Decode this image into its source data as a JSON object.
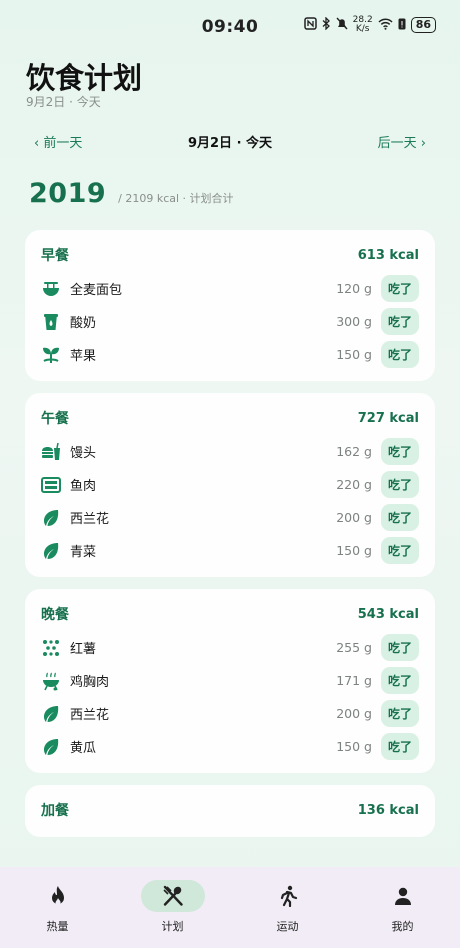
{
  "status_bar": {
    "time": "09:40",
    "speed_value": "28.2",
    "speed_unit": "K/s",
    "battery": "86"
  },
  "header": {
    "title": "饮食计划",
    "subtitle": "9月2日 · 今天"
  },
  "date_nav": {
    "prev": "‹ 前一天",
    "current": "9月2日 · 今天",
    "next": "后一天 ›"
  },
  "total": {
    "value": "2019",
    "label": "/ 2109 kcal · 计划合计"
  },
  "meals": [
    {
      "name": "早餐",
      "kcal": "613 kcal",
      "items": [
        {
          "icon": "noodle-bowl-icon",
          "name": "全麦面包",
          "weight": "120 g",
          "action": "吃了"
        },
        {
          "icon": "yogurt-cup-icon",
          "name": "酸奶",
          "weight": "300 g",
          "action": "吃了"
        },
        {
          "icon": "sprout-icon",
          "name": "苹果",
          "weight": "150 g",
          "action": "吃了"
        }
      ]
    },
    {
      "name": "午餐",
      "kcal": "727 kcal",
      "items": [
        {
          "icon": "fastfood-icon",
          "name": "馒头",
          "weight": "162 g",
          "action": "吃了"
        },
        {
          "icon": "bento-icon",
          "name": "鱼肉",
          "weight": "220 g",
          "action": "吃了"
        },
        {
          "icon": "leaf-icon",
          "name": "西兰花",
          "weight": "200 g",
          "action": "吃了"
        },
        {
          "icon": "leaf-icon",
          "name": "青菜",
          "weight": "150 g",
          "action": "吃了"
        }
      ]
    },
    {
      "name": "晚餐",
      "kcal": "543 kcal",
      "items": [
        {
          "icon": "grain-icon",
          "name": "红薯",
          "weight": "255 g",
          "action": "吃了"
        },
        {
          "icon": "grill-icon",
          "name": "鸡胸肉",
          "weight": "171 g",
          "action": "吃了"
        },
        {
          "icon": "leaf-icon",
          "name": "西兰花",
          "weight": "200 g",
          "action": "吃了"
        },
        {
          "icon": "leaf-icon",
          "name": "黄瓜",
          "weight": "150 g",
          "action": "吃了"
        }
      ]
    },
    {
      "name": "加餐",
      "kcal": "136 kcal",
      "items": []
    }
  ],
  "bottom_nav": [
    {
      "label": "热量",
      "icon": "flame-icon",
      "active": false
    },
    {
      "label": "计划",
      "icon": "utensils-icon",
      "active": true
    },
    {
      "label": "运动",
      "icon": "running-icon",
      "active": false
    },
    {
      "label": "我的",
      "icon": "person-icon",
      "active": false
    }
  ],
  "colors": {
    "accent": "#17704e",
    "button_bg": "#d9f1e4",
    "nav_bg": "#f1ecf5",
    "nav_active": "#cfe8d9"
  }
}
